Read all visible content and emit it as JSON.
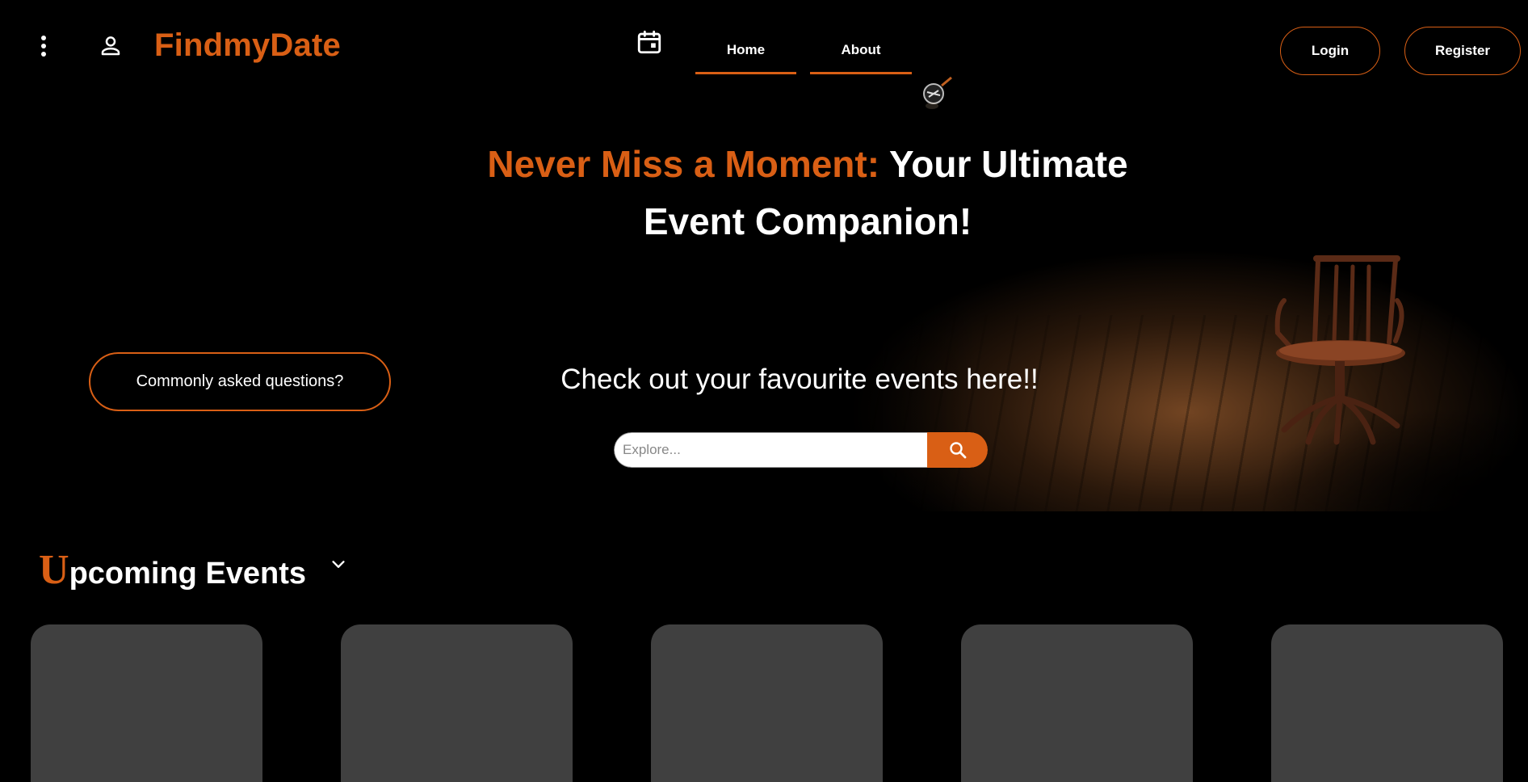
{
  "header": {
    "menu_icon": "more-vertical-icon",
    "profile_icon": "user-icon",
    "brand": "FindmyDate",
    "calendar_icon": "calendar-icon",
    "tabs": [
      {
        "label": "Home",
        "active": true
      },
      {
        "label": "About",
        "active": false
      }
    ],
    "login_label": "Login",
    "register_label": "Register"
  },
  "hero": {
    "headline_accent": "Never Miss a Moment:",
    "headline_line1": " Your Ultimate",
    "headline_line2": "Event Companion!",
    "faq_label": "Commonly asked questions?",
    "subheading": "Check out your favourite events here!!",
    "search": {
      "placeholder": "Explore...",
      "value": "",
      "button_icon": "search-icon"
    }
  },
  "upcoming": {
    "title_initial": "U",
    "title_rest": "pcoming Events",
    "toggle_icon": "chevron-down-icon",
    "card_count": 5
  },
  "colors": {
    "accent": "#d95f15",
    "background": "#000000",
    "card": "#404040"
  }
}
